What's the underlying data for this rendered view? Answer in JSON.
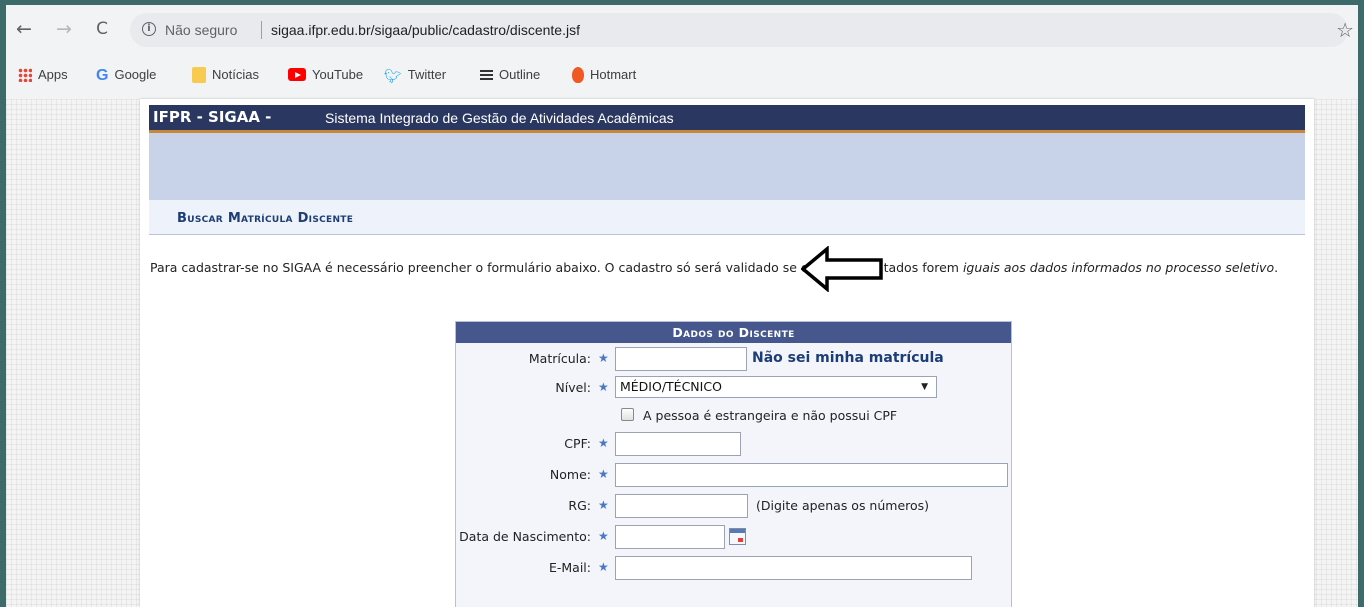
{
  "browser": {
    "nav": {
      "back": "←",
      "forward": "→",
      "reload": "C"
    },
    "security_label": "Não seguro",
    "url": "sigaa.ifpr.edu.br/sigaa/public/cadastro/discente.jsf",
    "bookmarks": [
      {
        "label": "Apps",
        "icon": "apps-grid-icon"
      },
      {
        "label": "Google",
        "icon": "google-icon"
      },
      {
        "label": "Notícias",
        "icon": "folder-icon"
      },
      {
        "label": "YouTube",
        "icon": "youtube-icon"
      },
      {
        "label": "Twitter",
        "icon": "twitter-icon"
      },
      {
        "label": "Outline",
        "icon": "outline-icon"
      },
      {
        "label": "Hotmart",
        "icon": "hotmart-icon"
      }
    ]
  },
  "header": {
    "acronym": "IFPR - SIGAA -",
    "system_name": "Sistema Integrado de Gestão de Atividades Acadêmicas"
  },
  "subheader": {
    "title": "Buscar Matrícula Discente"
  },
  "intro": {
    "text": "Para cadastrar-se no SIGAA é necessário preencher o formulário abaixo. O cadastro só será validado se os dados digitados forem ",
    "emphasis": "iguais aos dados informados no processo seletivo",
    "end": "."
  },
  "form": {
    "caption": "Dados do Discente",
    "matricula_label": "Matrícula:",
    "matricula_value": "",
    "matricula_link": "Não sei minha matrícula",
    "nivel_label": "Nível:",
    "nivel_value": "MÉDIO/TÉCNICO",
    "estrangeira_label": "A pessoa é estrangeira e não possui CPF",
    "cpf_label": "CPF:",
    "nome_label": "Nome:",
    "rg_label": "RG:",
    "rg_hint": "(Digite apenas os números)",
    "nascimento_label": "Data de Nascimento:",
    "email_label": "E-Mail:",
    "required_mark": "★"
  },
  "colors": {
    "header_bg": "#2a3760",
    "header_accent": "#c8883a",
    "band_bg": "#c8d3ea",
    "caption_bg": "#45578c",
    "link": "#1c3d76"
  }
}
